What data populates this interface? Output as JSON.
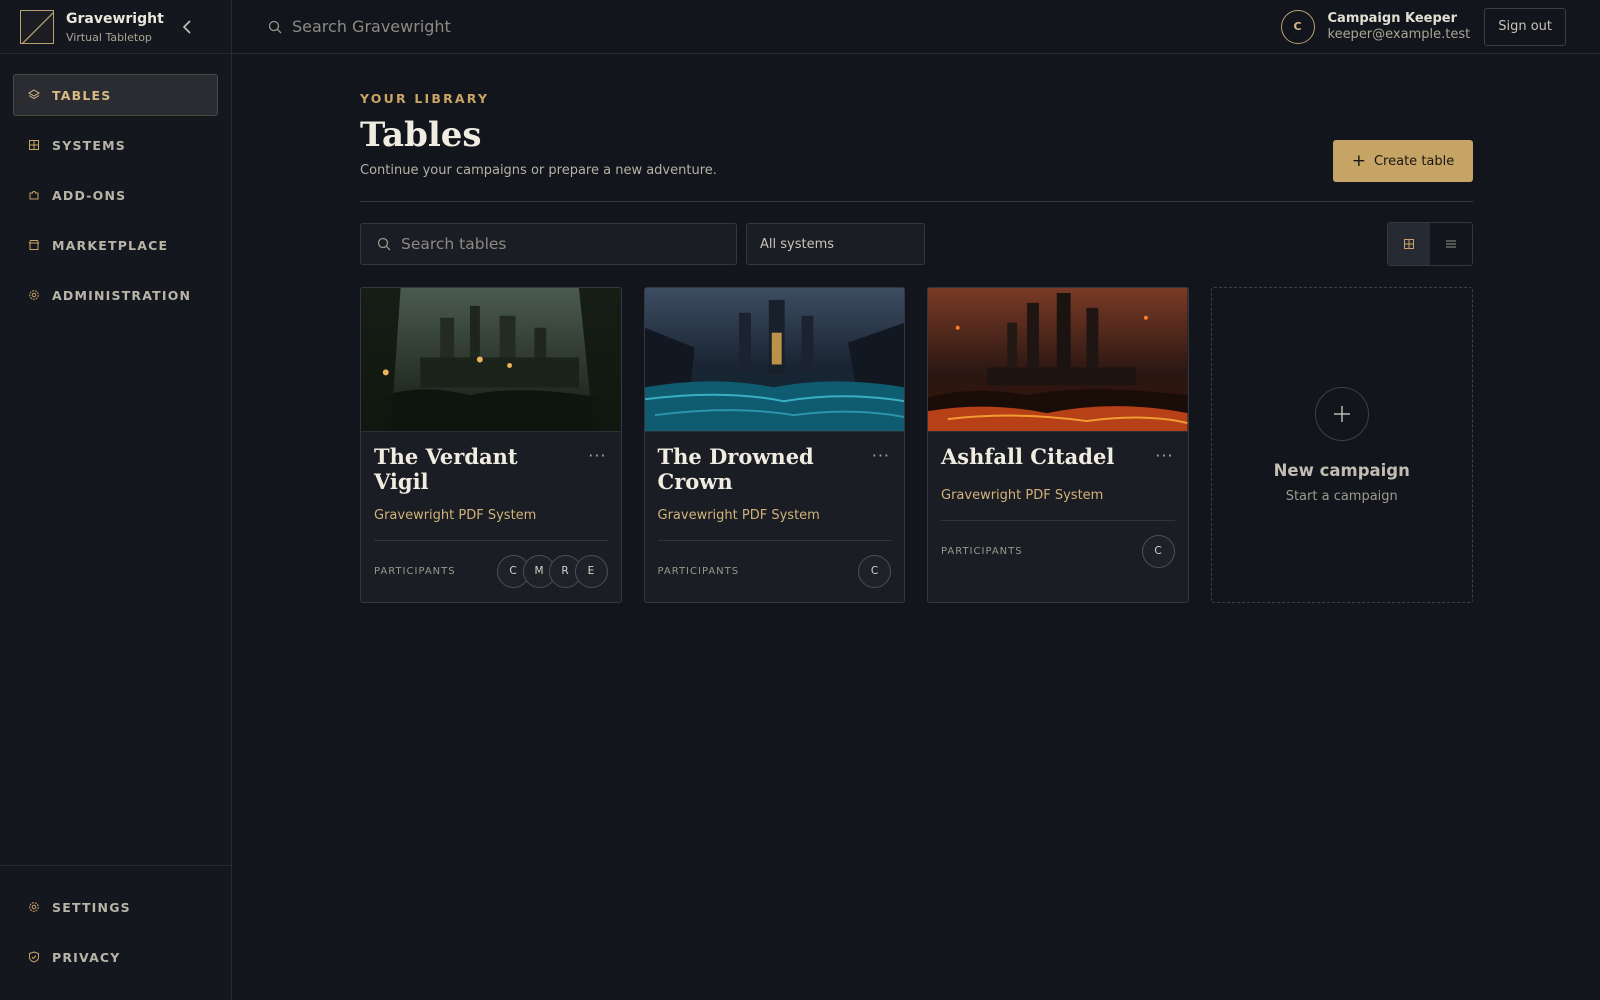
{
  "app": {
    "name": "Gravewright",
    "subtitle": "Virtual Tabletop"
  },
  "topbar": {
    "search_placeholder": "Search Gravewright"
  },
  "user": {
    "initial": "C",
    "name": "Campaign Keeper",
    "email": "keeper@example.test",
    "signout_label": "Sign out"
  },
  "sidebar": {
    "items": [
      {
        "label": "TABLES",
        "icon": "layers-icon",
        "active": true
      },
      {
        "label": "SYSTEMS",
        "icon": "grid-icon"
      },
      {
        "label": "ADD-ONS",
        "icon": "puzzle-icon"
      },
      {
        "label": "MARKETPLACE",
        "icon": "store-icon"
      },
      {
        "label": "ADMINISTRATION",
        "icon": "gear-icon"
      }
    ],
    "bottom_items": [
      {
        "label": "SETTINGS",
        "icon": "gear-icon"
      },
      {
        "label": "PRIVACY",
        "icon": "shield-icon"
      }
    ]
  },
  "main": {
    "eyebrow": "YOUR LIBRARY",
    "title": "Tables",
    "subtitle": "Continue your campaigns or prepare a new adventure.",
    "create_label": "Create table",
    "search_placeholder": "Search tables",
    "system_filter": "All systems",
    "view_mode": "grid"
  },
  "cards": [
    {
      "title": "The Verdant Vigil",
      "system": "Gravewright PDF System",
      "participants_label": "PARTICIPANTS",
      "participants": [
        "C",
        "M",
        "R",
        "E"
      ],
      "theme": "forest"
    },
    {
      "title": "The Drowned Crown",
      "system": "Gravewright PDF System",
      "participants_label": "PARTICIPANTS",
      "participants": [
        "C"
      ],
      "theme": "ocean"
    },
    {
      "title": "Ashfall Citadel",
      "system": "Gravewright PDF System",
      "participants_label": "PARTICIPANTS",
      "participants": [
        "C"
      ],
      "theme": "lava"
    }
  ],
  "new_card": {
    "title": "New campaign",
    "subtitle": "Start a campaign"
  },
  "colors": {
    "accent": "#c6a465",
    "background": "#12151b",
    "card": "#1a1d23"
  }
}
